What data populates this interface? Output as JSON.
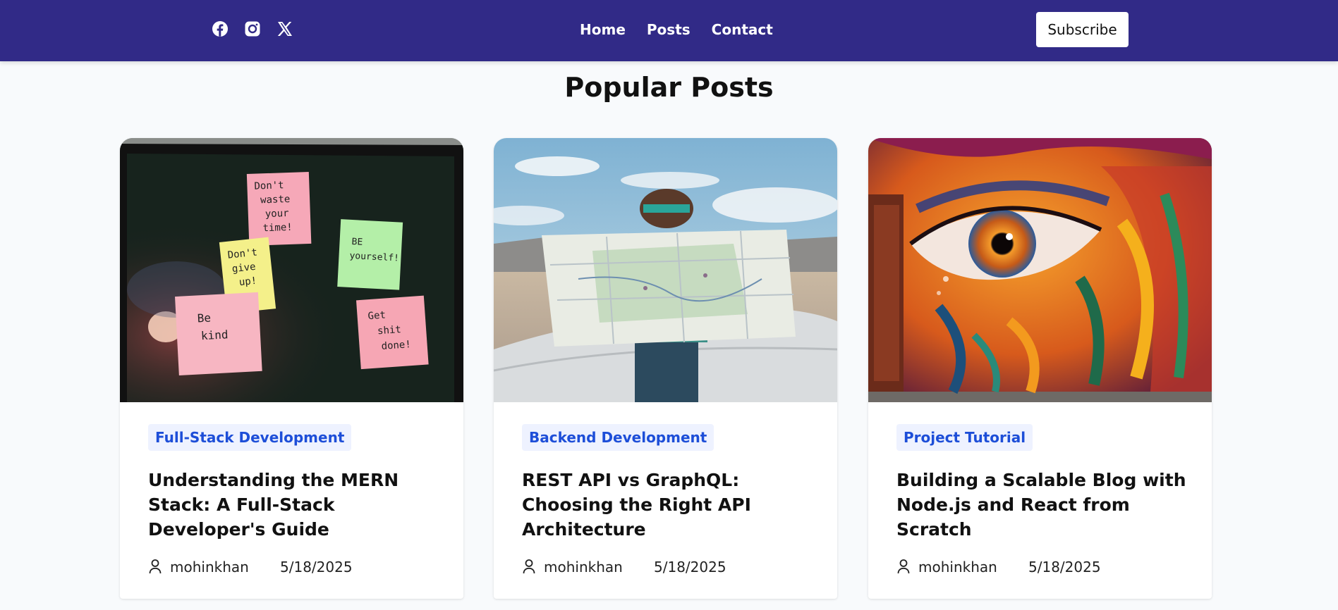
{
  "header": {
    "social": [
      "facebook-icon",
      "instagram-icon",
      "x-icon"
    ],
    "nav": [
      "Home",
      "Posts",
      "Contact"
    ],
    "subscribe_label": "Subscribe",
    "colors": {
      "navbar": "#312a87",
      "badge_bg": "#eef2ff",
      "badge_text": "#1d4ed8"
    }
  },
  "main": {
    "section_title": "Popular Posts",
    "posts": [
      {
        "category": "Full-Stack Development",
        "title": "Understanding the MERN Stack: A Full-Stack Developer's Guide",
        "author": "mohinkhan",
        "date": "5/18/2025",
        "image": "sticky-notes-on-monitor",
        "notes": [
          "Don't waste your time!",
          "Don't give up!",
          "Be yourself!",
          "Be kind",
          "Get shit done!"
        ]
      },
      {
        "category": "Backend Development",
        "title": "REST API vs GraphQL: Choosing the Right API Architecture",
        "author": "mohinkhan",
        "date": "5/18/2025",
        "image": "person-reading-map"
      },
      {
        "category": "Project Tutorial",
        "title": "Building a Scalable Blog with Node.js and React from Scratch",
        "author": "mohinkhan",
        "date": "5/18/2025",
        "image": "eye-graffiti-mural"
      }
    ]
  }
}
